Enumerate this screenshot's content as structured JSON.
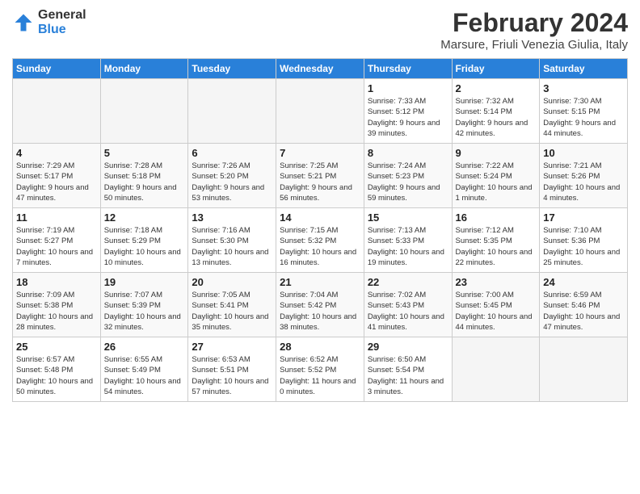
{
  "logo": {
    "general": "General",
    "blue": "Blue"
  },
  "title": {
    "month_year": "February 2024",
    "location": "Marsure, Friuli Venezia Giulia, Italy"
  },
  "days_of_week": [
    "Sunday",
    "Monday",
    "Tuesday",
    "Wednesday",
    "Thursday",
    "Friday",
    "Saturday"
  ],
  "weeks": [
    [
      {
        "day": "",
        "empty": true
      },
      {
        "day": "",
        "empty": true
      },
      {
        "day": "",
        "empty": true
      },
      {
        "day": "",
        "empty": true
      },
      {
        "day": "1",
        "sunrise": "7:33 AM",
        "sunset": "5:12 PM",
        "daylight": "9 hours and 39 minutes."
      },
      {
        "day": "2",
        "sunrise": "7:32 AM",
        "sunset": "5:14 PM",
        "daylight": "9 hours and 42 minutes."
      },
      {
        "day": "3",
        "sunrise": "7:30 AM",
        "sunset": "5:15 PM",
        "daylight": "9 hours and 44 minutes."
      }
    ],
    [
      {
        "day": "4",
        "sunrise": "7:29 AM",
        "sunset": "5:17 PM",
        "daylight": "9 hours and 47 minutes."
      },
      {
        "day": "5",
        "sunrise": "7:28 AM",
        "sunset": "5:18 PM",
        "daylight": "9 hours and 50 minutes."
      },
      {
        "day": "6",
        "sunrise": "7:26 AM",
        "sunset": "5:20 PM",
        "daylight": "9 hours and 53 minutes."
      },
      {
        "day": "7",
        "sunrise": "7:25 AM",
        "sunset": "5:21 PM",
        "daylight": "9 hours and 56 minutes."
      },
      {
        "day": "8",
        "sunrise": "7:24 AM",
        "sunset": "5:23 PM",
        "daylight": "9 hours and 59 minutes."
      },
      {
        "day": "9",
        "sunrise": "7:22 AM",
        "sunset": "5:24 PM",
        "daylight": "10 hours and 1 minute."
      },
      {
        "day": "10",
        "sunrise": "7:21 AM",
        "sunset": "5:26 PM",
        "daylight": "10 hours and 4 minutes."
      }
    ],
    [
      {
        "day": "11",
        "sunrise": "7:19 AM",
        "sunset": "5:27 PM",
        "daylight": "10 hours and 7 minutes."
      },
      {
        "day": "12",
        "sunrise": "7:18 AM",
        "sunset": "5:29 PM",
        "daylight": "10 hours and 10 minutes."
      },
      {
        "day": "13",
        "sunrise": "7:16 AM",
        "sunset": "5:30 PM",
        "daylight": "10 hours and 13 minutes."
      },
      {
        "day": "14",
        "sunrise": "7:15 AM",
        "sunset": "5:32 PM",
        "daylight": "10 hours and 16 minutes."
      },
      {
        "day": "15",
        "sunrise": "7:13 AM",
        "sunset": "5:33 PM",
        "daylight": "10 hours and 19 minutes."
      },
      {
        "day": "16",
        "sunrise": "7:12 AM",
        "sunset": "5:35 PM",
        "daylight": "10 hours and 22 minutes."
      },
      {
        "day": "17",
        "sunrise": "7:10 AM",
        "sunset": "5:36 PM",
        "daylight": "10 hours and 25 minutes."
      }
    ],
    [
      {
        "day": "18",
        "sunrise": "7:09 AM",
        "sunset": "5:38 PM",
        "daylight": "10 hours and 28 minutes."
      },
      {
        "day": "19",
        "sunrise": "7:07 AM",
        "sunset": "5:39 PM",
        "daylight": "10 hours and 32 minutes."
      },
      {
        "day": "20",
        "sunrise": "7:05 AM",
        "sunset": "5:41 PM",
        "daylight": "10 hours and 35 minutes."
      },
      {
        "day": "21",
        "sunrise": "7:04 AM",
        "sunset": "5:42 PM",
        "daylight": "10 hours and 38 minutes."
      },
      {
        "day": "22",
        "sunrise": "7:02 AM",
        "sunset": "5:43 PM",
        "daylight": "10 hours and 41 minutes."
      },
      {
        "day": "23",
        "sunrise": "7:00 AM",
        "sunset": "5:45 PM",
        "daylight": "10 hours and 44 minutes."
      },
      {
        "day": "24",
        "sunrise": "6:59 AM",
        "sunset": "5:46 PM",
        "daylight": "10 hours and 47 minutes."
      }
    ],
    [
      {
        "day": "25",
        "sunrise": "6:57 AM",
        "sunset": "5:48 PM",
        "daylight": "10 hours and 50 minutes."
      },
      {
        "day": "26",
        "sunrise": "6:55 AM",
        "sunset": "5:49 PM",
        "daylight": "10 hours and 54 minutes."
      },
      {
        "day": "27",
        "sunrise": "6:53 AM",
        "sunset": "5:51 PM",
        "daylight": "10 hours and 57 minutes."
      },
      {
        "day": "28",
        "sunrise": "6:52 AM",
        "sunset": "5:52 PM",
        "daylight": "11 hours and 0 minutes."
      },
      {
        "day": "29",
        "sunrise": "6:50 AM",
        "sunset": "5:54 PM",
        "daylight": "11 hours and 3 minutes."
      },
      {
        "day": "",
        "empty": true
      },
      {
        "day": "",
        "empty": true
      }
    ]
  ]
}
